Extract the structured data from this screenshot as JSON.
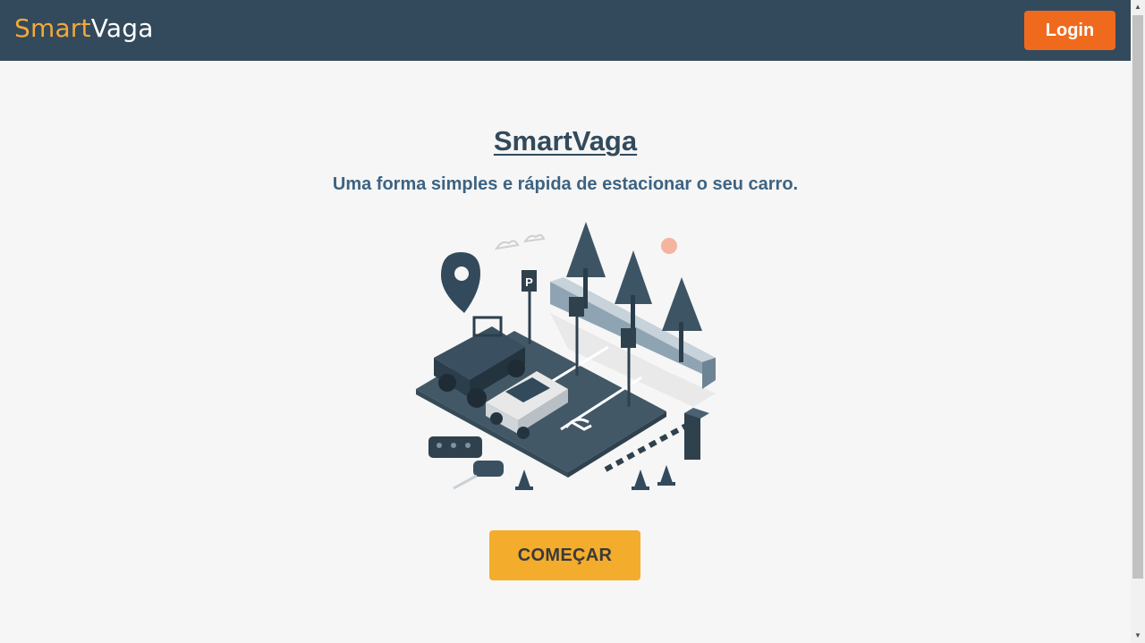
{
  "navbar": {
    "brand_part1": "Smart",
    "brand_part2": "Vaga",
    "login_label": "Login"
  },
  "hero": {
    "title": "SmartVaga",
    "subtitle": "Uma forma simples e rápida de estacionar o seu carro.",
    "illustration_icon": "parking-lot-illustration",
    "cta_label": "COMEÇAR"
  },
  "colors": {
    "navbar_bg": "#324a5b",
    "brand_accent": "#f2a93b",
    "login_button": "#f06a1e",
    "cta_button": "#f3ac2c",
    "title_color": "#324a5b",
    "subtitle_color": "#3d6382",
    "page_bg": "#f6f6f6"
  },
  "scrollbar": {
    "up_icon": "▲",
    "down_icon": "▼"
  }
}
